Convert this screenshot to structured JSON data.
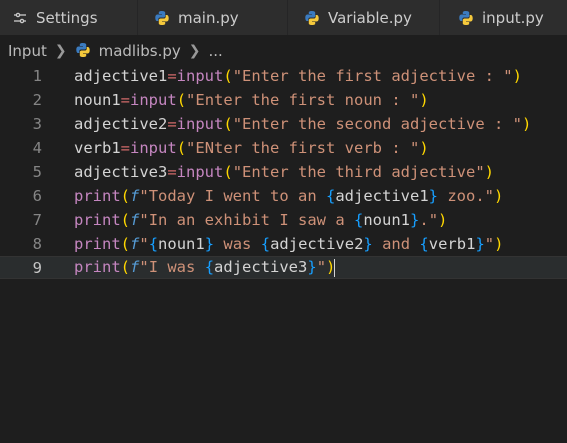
{
  "tabs": [
    {
      "label": "Settings",
      "icon": "settings-icon"
    },
    {
      "label": "main.py",
      "icon": "python-icon"
    },
    {
      "label": "Variable.py",
      "icon": "python-icon"
    },
    {
      "label": "input.py",
      "icon": "python-icon"
    }
  ],
  "breadcrumb": {
    "folder": "Input",
    "file": "madlibs.py",
    "ellipsis": "..."
  },
  "editor": {
    "current_line": 9,
    "lines": [
      {
        "num": "1",
        "text": "adjective1=input(\"Enter the first adjective : \")"
      },
      {
        "num": "2",
        "text": "noun1=input(\"Enter the first noun : \")"
      },
      {
        "num": "3",
        "text": "adjective2=input(\"Enter the second adjective : \")"
      },
      {
        "num": "4",
        "text": "verb1=input(\"ENter the first verb : \")"
      },
      {
        "num": "5",
        "text": "adjective3=input(\"Enter the third adjective\")"
      },
      {
        "num": "6",
        "text": "print(f\"Today I went to an {adjective1} zoo.\")"
      },
      {
        "num": "7",
        "text": "print(f\"In an exhibit I saw a {noun1}.\")"
      },
      {
        "num": "8",
        "text": "print(f\"{noun1} was {adjective2} and {verb1}\")"
      },
      {
        "num": "9",
        "text": "print(f\"I was {adjective3}\")"
      }
    ]
  },
  "colors": {
    "background": "#1e1e1e",
    "function": "#dcdcaa",
    "string": "#ce9178",
    "bracket1": "#ffd700",
    "bracket2": "#da70d6"
  }
}
